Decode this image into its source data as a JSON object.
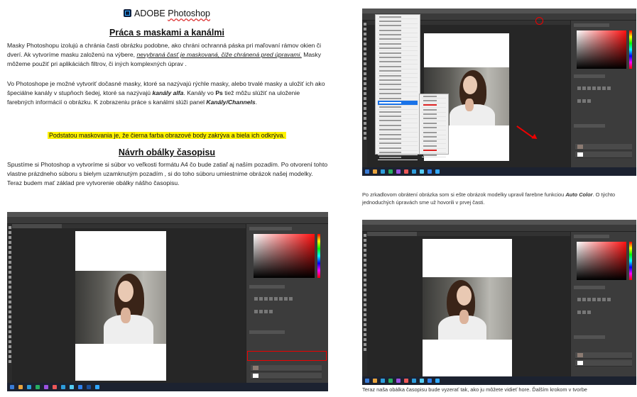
{
  "document": {
    "brand": "ADOBE",
    "brand_app": "Photoshop",
    "heading_1": "Práca s maskami a kanálmi",
    "para_1_a": "Masky Photoshopu izolujú a chránia časti obrázku podobne, ako chráni ochranná páska pri maľovaní rámov okien či dverí. Ak vytvoríme masku založenú na výbere, ",
    "para_1_u": "nevybraná časť je maskovaná, čiže chránená pred úpravami.",
    "para_1_b": " Masky môžeme použiť pri aplikáciách filtrov, či iných komplexných úprav .",
    "para_2_a": "Vo Photoshope je možné vytvoriť dočasné masky, ktoré sa nazývajú rýchle masky, alebo trvalé masky a uložiť ich ako špeciálne kanály v stupňoch šedej, ktoré sa nazývajú ",
    "para_2_b": "kanály alfa",
    "para_2_c": ". Kanály vo ",
    "para_2_d": "Ps",
    "para_2_e": " tiež môžu slúžiť na uloženie farebných informácií o obrázku. K zobrazeniu práce s kanálmi slúži panel ",
    "para_2_f": "Kanály/Channels",
    "para_2_g": ".",
    "highlight": "Podstatou maskovania je, že čierna farba obrazové body zakrýva a biela ich odkrýva.",
    "heading_2": "Návrh obálky časopisu",
    "para_3": "Spustíme si Photoshop a vytvoríme si súbor vo veľkosti formátu A4 čo bude zatiaľ aj naším pozadím. Po otvorení tohto vlastne prázdneho súboru s bielym uzamknutým pozadím , si do toho súboru umiestnime obrázok našej modelky. Teraz budem mať základ pre vytvorenie obálky nášho časopisu.",
    "caption_1_a": "Po zrkadlovom obrátení obrázka som si ešte obrázok modelky upravil farebne funkciou ",
    "caption_1_b": "Auto Color",
    "caption_1_c": ". O týchto jednoduchých úpravách sme už hovorili v prvej časti.",
    "caption_2": "Teraz naša obálka časopisu bude vyzerať tak, ako ju môžete vidieť hore. Ďalším krokom v tvorbe"
  },
  "colors": {
    "highlight": "#fff200",
    "annotation_red": "#ee0000",
    "ps_dark": "#323232",
    "ps_logo": "#31a8ff"
  },
  "icons": [
    "photoshop-logo-icon",
    "arrow-annotation-icon"
  ]
}
